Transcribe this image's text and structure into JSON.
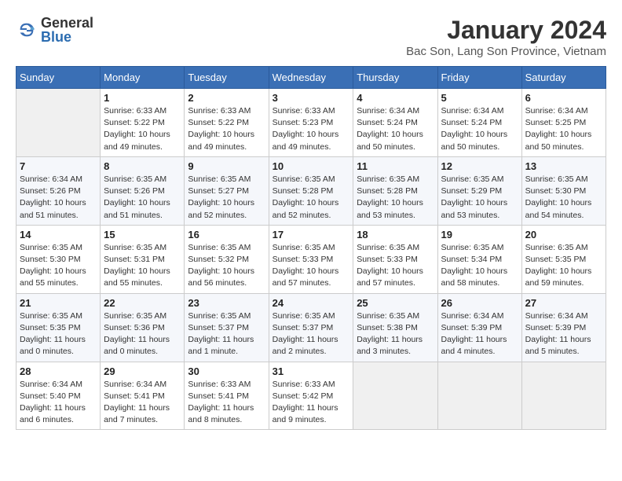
{
  "header": {
    "logo": {
      "general": "General",
      "blue": "Blue"
    },
    "title": "January 2024",
    "subtitle": "Bac Son, Lang Son Province, Vietnam"
  },
  "calendar": {
    "days_of_week": [
      "Sunday",
      "Monday",
      "Tuesday",
      "Wednesday",
      "Thursday",
      "Friday",
      "Saturday"
    ],
    "weeks": [
      [
        {
          "day": "",
          "info": ""
        },
        {
          "day": "1",
          "info": "Sunrise: 6:33 AM\nSunset: 5:22 PM\nDaylight: 10 hours\nand 49 minutes."
        },
        {
          "day": "2",
          "info": "Sunrise: 6:33 AM\nSunset: 5:22 PM\nDaylight: 10 hours\nand 49 minutes."
        },
        {
          "day": "3",
          "info": "Sunrise: 6:33 AM\nSunset: 5:23 PM\nDaylight: 10 hours\nand 49 minutes."
        },
        {
          "day": "4",
          "info": "Sunrise: 6:34 AM\nSunset: 5:24 PM\nDaylight: 10 hours\nand 50 minutes."
        },
        {
          "day": "5",
          "info": "Sunrise: 6:34 AM\nSunset: 5:24 PM\nDaylight: 10 hours\nand 50 minutes."
        },
        {
          "day": "6",
          "info": "Sunrise: 6:34 AM\nSunset: 5:25 PM\nDaylight: 10 hours\nand 50 minutes."
        }
      ],
      [
        {
          "day": "7",
          "info": "Sunrise: 6:34 AM\nSunset: 5:26 PM\nDaylight: 10 hours\nand 51 minutes."
        },
        {
          "day": "8",
          "info": "Sunrise: 6:35 AM\nSunset: 5:26 PM\nDaylight: 10 hours\nand 51 minutes."
        },
        {
          "day": "9",
          "info": "Sunrise: 6:35 AM\nSunset: 5:27 PM\nDaylight: 10 hours\nand 52 minutes."
        },
        {
          "day": "10",
          "info": "Sunrise: 6:35 AM\nSunset: 5:28 PM\nDaylight: 10 hours\nand 52 minutes."
        },
        {
          "day": "11",
          "info": "Sunrise: 6:35 AM\nSunset: 5:28 PM\nDaylight: 10 hours\nand 53 minutes."
        },
        {
          "day": "12",
          "info": "Sunrise: 6:35 AM\nSunset: 5:29 PM\nDaylight: 10 hours\nand 53 minutes."
        },
        {
          "day": "13",
          "info": "Sunrise: 6:35 AM\nSunset: 5:30 PM\nDaylight: 10 hours\nand 54 minutes."
        }
      ],
      [
        {
          "day": "14",
          "info": "Sunrise: 6:35 AM\nSunset: 5:30 PM\nDaylight: 10 hours\nand 55 minutes."
        },
        {
          "day": "15",
          "info": "Sunrise: 6:35 AM\nSunset: 5:31 PM\nDaylight: 10 hours\nand 55 minutes."
        },
        {
          "day": "16",
          "info": "Sunrise: 6:35 AM\nSunset: 5:32 PM\nDaylight: 10 hours\nand 56 minutes."
        },
        {
          "day": "17",
          "info": "Sunrise: 6:35 AM\nSunset: 5:33 PM\nDaylight: 10 hours\nand 57 minutes."
        },
        {
          "day": "18",
          "info": "Sunrise: 6:35 AM\nSunset: 5:33 PM\nDaylight: 10 hours\nand 57 minutes."
        },
        {
          "day": "19",
          "info": "Sunrise: 6:35 AM\nSunset: 5:34 PM\nDaylight: 10 hours\nand 58 minutes."
        },
        {
          "day": "20",
          "info": "Sunrise: 6:35 AM\nSunset: 5:35 PM\nDaylight: 10 hours\nand 59 minutes."
        }
      ],
      [
        {
          "day": "21",
          "info": "Sunrise: 6:35 AM\nSunset: 5:35 PM\nDaylight: 11 hours\nand 0 minutes."
        },
        {
          "day": "22",
          "info": "Sunrise: 6:35 AM\nSunset: 5:36 PM\nDaylight: 11 hours\nand 0 minutes."
        },
        {
          "day": "23",
          "info": "Sunrise: 6:35 AM\nSunset: 5:37 PM\nDaylight: 11 hours\nand 1 minute."
        },
        {
          "day": "24",
          "info": "Sunrise: 6:35 AM\nSunset: 5:37 PM\nDaylight: 11 hours\nand 2 minutes."
        },
        {
          "day": "25",
          "info": "Sunrise: 6:35 AM\nSunset: 5:38 PM\nDaylight: 11 hours\nand 3 minutes."
        },
        {
          "day": "26",
          "info": "Sunrise: 6:34 AM\nSunset: 5:39 PM\nDaylight: 11 hours\nand 4 minutes."
        },
        {
          "day": "27",
          "info": "Sunrise: 6:34 AM\nSunset: 5:39 PM\nDaylight: 11 hours\nand 5 minutes."
        }
      ],
      [
        {
          "day": "28",
          "info": "Sunrise: 6:34 AM\nSunset: 5:40 PM\nDaylight: 11 hours\nand 6 minutes."
        },
        {
          "day": "29",
          "info": "Sunrise: 6:34 AM\nSunset: 5:41 PM\nDaylight: 11 hours\nand 7 minutes."
        },
        {
          "day": "30",
          "info": "Sunrise: 6:33 AM\nSunset: 5:41 PM\nDaylight: 11 hours\nand 8 minutes."
        },
        {
          "day": "31",
          "info": "Sunrise: 6:33 AM\nSunset: 5:42 PM\nDaylight: 11 hours\nand 9 minutes."
        },
        {
          "day": "",
          "info": ""
        },
        {
          "day": "",
          "info": ""
        },
        {
          "day": "",
          "info": ""
        }
      ]
    ]
  }
}
